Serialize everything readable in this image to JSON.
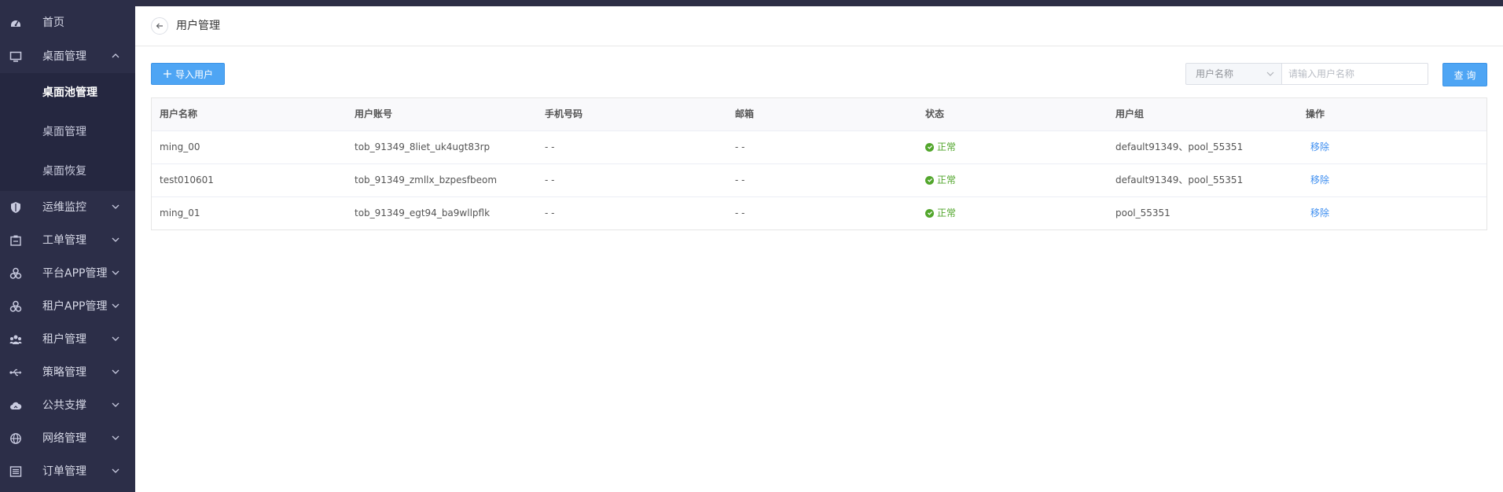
{
  "sidebar": {
    "items": [
      {
        "label": "首页",
        "icon": "dashboard-icon"
      },
      {
        "label": "桌面管理",
        "icon": "monitor-icon",
        "expanded": true
      },
      {
        "label": "运维监控",
        "icon": "shield-icon"
      },
      {
        "label": "工单管理",
        "icon": "ticket-icon"
      },
      {
        "label": "平台APP管理",
        "icon": "apps-icon"
      },
      {
        "label": "租户APP管理",
        "icon": "apps-icon"
      },
      {
        "label": "租户管理",
        "icon": "users-icon"
      },
      {
        "label": "策略管理",
        "icon": "usb-icon"
      },
      {
        "label": "公共支撑",
        "icon": "cloud-icon"
      },
      {
        "label": "网络管理",
        "icon": "globe-icon"
      },
      {
        "label": "订单管理",
        "icon": "list-icon"
      }
    ],
    "subitems": [
      {
        "label": "桌面池管理",
        "active": true
      },
      {
        "label": "桌面管理"
      },
      {
        "label": "桌面恢复"
      }
    ]
  },
  "header": {
    "title": "用户管理"
  },
  "toolbar": {
    "import_label": "导入用户",
    "search_field": "用户名称",
    "search_placeholder": "请输入用户名称",
    "query_label": "查 询"
  },
  "table": {
    "columns": [
      "用户名称",
      "用户账号",
      "手机号码",
      "邮箱",
      "状态",
      "用户组",
      "操作"
    ],
    "rows": [
      {
        "name": "ming_00",
        "account": "tob_91349_8liet_uk4ugt83rp",
        "phone": "- -",
        "email": "- -",
        "status": "正常",
        "group": "default91349、pool_55351",
        "action": "移除"
      },
      {
        "name": "test010601",
        "account": "tob_91349_zmllx_bzpesfbeom",
        "phone": "- -",
        "email": "- -",
        "status": "正常",
        "group": "default91349、pool_55351",
        "action": "移除"
      },
      {
        "name": "ming_01",
        "account": "tob_91349_egt94_ba9wllpflk",
        "phone": "- -",
        "email": "- -",
        "status": "正常",
        "group": "pool_55351",
        "action": "移除"
      }
    ]
  },
  "colors": {
    "sidebar": "#2c2e48",
    "primary": "#4ea5f4",
    "success": "#52a62c",
    "link": "#3d8ef0"
  }
}
